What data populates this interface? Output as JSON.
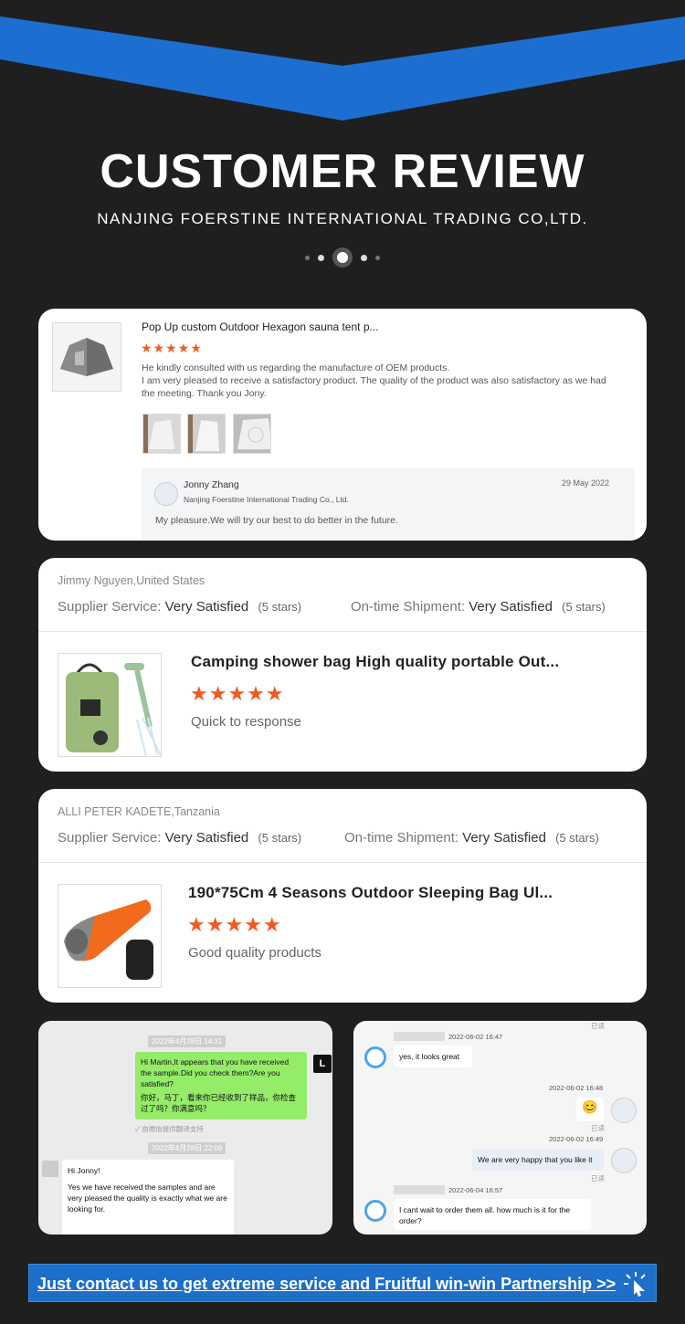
{
  "header": {
    "title": "CUSTOMER REVIEW",
    "subtitle": "NANJING FOERSTINE INTERNATIONAL TRADING CO,LTD.",
    "accent_color": "#1c6fd1"
  },
  "review1": {
    "product_title": "Pop Up custom Outdoor Hexagon sauna tent p...",
    "stars": "★★★★★",
    "text_line1": "He kindly consulted with us regarding the manufacture of OEM products.",
    "text_line2": "I am very pleased to receive a satisfactory product. The quality of the product was also satisfactory as we had the meeting. Thank you Jony.",
    "reply": {
      "name": "Jonny Zhang",
      "company": "Nanjing Foerstine International Trading Co., Ltd.",
      "date": "29 May 2022",
      "text": "My pleasure.We will try our best to do better in the future."
    }
  },
  "review2": {
    "reviewer": "Jimmy Nguyen,United States",
    "supplier_label": "Supplier Service:",
    "supplier_value": "Very Satisfied",
    "supplier_stars": "(5 stars)",
    "shipment_label": "On-time Shipment:",
    "shipment_value": "Very Satisfied",
    "shipment_stars": "(5 stars)",
    "product_title": "Camping shower bag High quality portable Out...",
    "stars": "★★★★★",
    "comment": "Quick to response"
  },
  "review3": {
    "reviewer": "ALLI PETER KADETE,Tanzania",
    "supplier_label": "Supplier Service:",
    "supplier_value": "Very Satisfied",
    "supplier_stars": "(5 stars)",
    "shipment_label": "On-time Shipment:",
    "shipment_value": "Very Satisfied",
    "shipment_stars": "(5 stars)",
    "product_title": "190*75Cm 4 Seasons Outdoor Sleeping Bag Ul...",
    "stars": "★★★★★",
    "comment": "Good quality products"
  },
  "chat_left": {
    "ts1": "2022年4月28日 14:31",
    "msg1_en": "Hi Martin,It appears that you have received the sample.Did you check them?Are you satisfied?",
    "msg1_cn": "你好，马丁，看来你已经收到了样品，你检查过了吗？你满意吗？",
    "translated": "✓ 由微信提供翻译支持",
    "avatar_letter": "L",
    "ts2": "2022年4月28日 22:06",
    "msg2_hi": "Hi Jonny!",
    "msg2_body": "Yes we have received the samples and are very pleased the quality is exactly what we are looking for."
  },
  "chat_right": {
    "read": "已读",
    "ts1": "2022-06-02 16:47",
    "msg1": "yes, it looks great",
    "ts2": "2022-06-02 16:48",
    "emoji": "😊",
    "ts3": "2022-06-02 16:49",
    "msg3": "We are very happy that you like it",
    "ts4": "2022-06-04 16:57",
    "msg4": "I cant wait to order them all. how much is it for the order?"
  },
  "footer": {
    "cta": "Just contact us to get extreme service and Fruitful win-win Partnership >>"
  }
}
